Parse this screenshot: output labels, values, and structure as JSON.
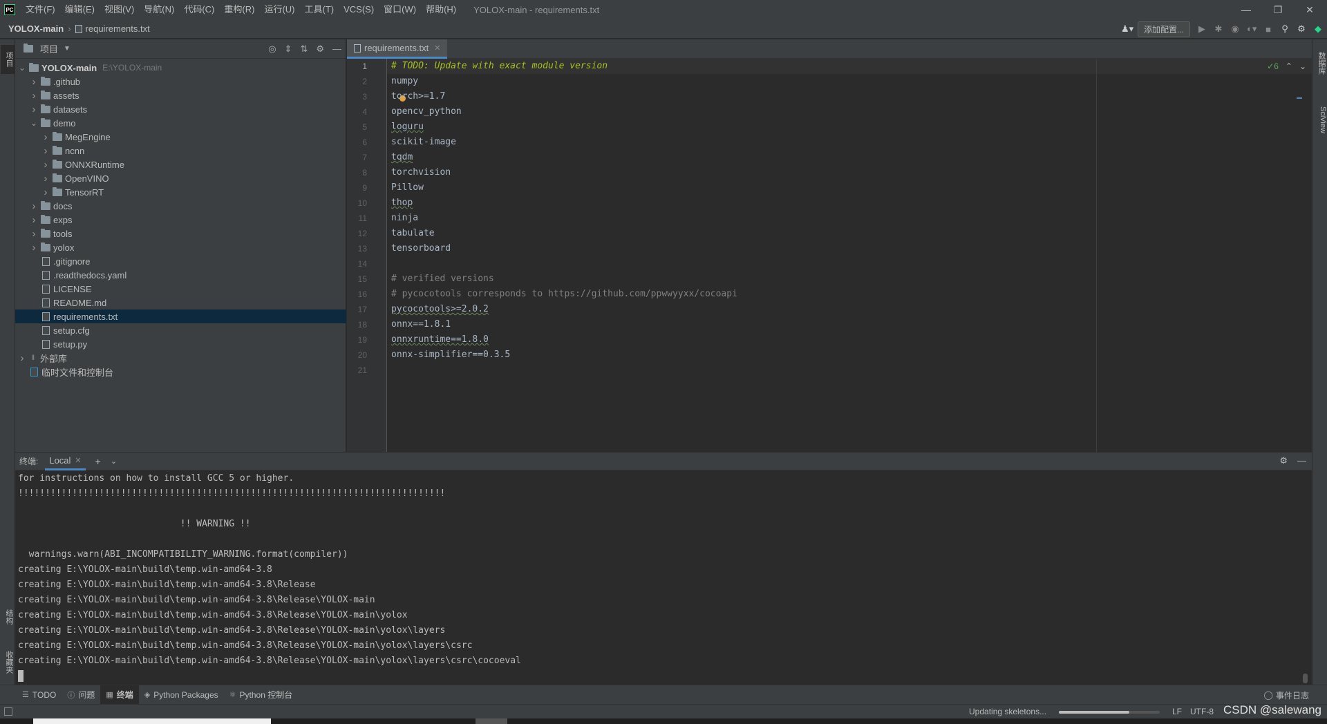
{
  "titlebar": {
    "app_icon": "PC",
    "menu": [
      "文件(F)",
      "编辑(E)",
      "视图(V)",
      "导航(N)",
      "代码(C)",
      "重构(R)",
      "运行(U)",
      "工具(T)",
      "VCS(S)",
      "窗口(W)",
      "帮助(H)"
    ],
    "window_title": "YOLOX-main - requirements.txt"
  },
  "navbar": {
    "project": "YOLOX-main",
    "file": "requirements.txt",
    "add_config": "添加配置..."
  },
  "left_strip": {
    "project_tab": "项目",
    "structure_tab": "结构",
    "favorites_tab": "收藏夹"
  },
  "right_strip": {
    "database_tab": "数据库",
    "sciview_tab": "SciView"
  },
  "project_panel": {
    "title": "项目",
    "root": {
      "name": "YOLOX-main",
      "path": "E:\\YOLOX-main"
    },
    "items": [
      {
        "label": ".github",
        "kind": "folder",
        "expanded": false
      },
      {
        "label": "assets",
        "kind": "folder",
        "expanded": false
      },
      {
        "label": "datasets",
        "kind": "folder",
        "expanded": false
      },
      {
        "label": "demo",
        "kind": "folder",
        "expanded": true
      },
      {
        "label": "MegEngine",
        "kind": "folder",
        "expanded": false
      },
      {
        "label": "ncnn",
        "kind": "folder",
        "expanded": false
      },
      {
        "label": "ONNXRuntime",
        "kind": "folder",
        "expanded": false
      },
      {
        "label": "OpenVINO",
        "kind": "folder",
        "expanded": false
      },
      {
        "label": "TensorRT",
        "kind": "folder",
        "expanded": false
      },
      {
        "label": "docs",
        "kind": "folder",
        "expanded": false
      },
      {
        "label": "exps",
        "kind": "folder",
        "expanded": false
      },
      {
        "label": "tools",
        "kind": "folder",
        "expanded": false
      },
      {
        "label": "yolox",
        "kind": "folder",
        "expanded": false
      },
      {
        "label": ".gitignore",
        "kind": "file"
      },
      {
        "label": ".readthedocs.yaml",
        "kind": "file"
      },
      {
        "label": "LICENSE",
        "kind": "file"
      },
      {
        "label": "README.md",
        "kind": "file"
      },
      {
        "label": "requirements.txt",
        "kind": "file",
        "selected": true
      },
      {
        "label": "setup.cfg",
        "kind": "file"
      },
      {
        "label": "setup.py",
        "kind": "file"
      },
      {
        "label": "外部库",
        "kind": "library"
      },
      {
        "label": "临时文件和控制台",
        "kind": "scratch"
      }
    ]
  },
  "editor": {
    "tab_label": "requirements.txt",
    "inspection_count": "6",
    "current_line": 1,
    "lines": [
      "# TODO: Update with exact module version",
      "numpy",
      "torch>=1.7",
      "opencv_python",
      "loguru",
      "scikit-image",
      "tqdm",
      "torchvision",
      "Pillow",
      "thop",
      "ninja",
      "tabulate",
      "tensorboard",
      "",
      "# verified versions",
      "# pycocotools corresponds to https://github.com/ppwwyyxx/cocoapi",
      "pycocotools>=2.0.2",
      "onnx==1.8.1",
      "onnxruntime==1.8.0",
      "onnx-simplifier==0.3.5",
      ""
    ]
  },
  "terminal": {
    "title": "终端:",
    "tab_label": "Local",
    "lines": [
      "for instructions on how to install GCC 5 or higher.",
      "!!!!!!!!!!!!!!!!!!!!!!!!!!!!!!!!!!!!!!!!!!!!!!!!!!!!!!!!!!!!!!!!!!!!!!!!!!!!!!!",
      "",
      "                              !! WARNING !!",
      "",
      "  warnings.warn(ABI_INCOMPATIBILITY_WARNING.format(compiler))",
      "creating E:\\YOLOX-main\\build\\temp.win-amd64-3.8",
      "creating E:\\YOLOX-main\\build\\temp.win-amd64-3.8\\Release",
      "creating E:\\YOLOX-main\\build\\temp.win-amd64-3.8\\Release\\YOLOX-main",
      "creating E:\\YOLOX-main\\build\\temp.win-amd64-3.8\\Release\\YOLOX-main\\yolox",
      "creating E:\\YOLOX-main\\build\\temp.win-amd64-3.8\\Release\\YOLOX-main\\yolox\\layers",
      "creating E:\\YOLOX-main\\build\\temp.win-amd64-3.8\\Release\\YOLOX-main\\yolox\\layers\\csrc",
      "creating E:\\YOLOX-main\\build\\temp.win-amd64-3.8\\Release\\YOLOX-main\\yolox\\layers\\csrc\\cocoeval"
    ]
  },
  "tool_tabs": {
    "todo": "TODO",
    "problems": "问题",
    "terminal": "终端",
    "python_packages": "Python Packages",
    "python_console": "Python 控制台",
    "event_log": "事件日志"
  },
  "statusbar": {
    "status_text": "Updating skeletons...",
    "progress": 0.7,
    "line_separator": "LF",
    "encoding": "UTF-8",
    "watermark": "CSDN @salewang"
  },
  "colors": {
    "accent": "#4a88c7",
    "selection": "#0d293e",
    "todo": "#a8c023"
  }
}
